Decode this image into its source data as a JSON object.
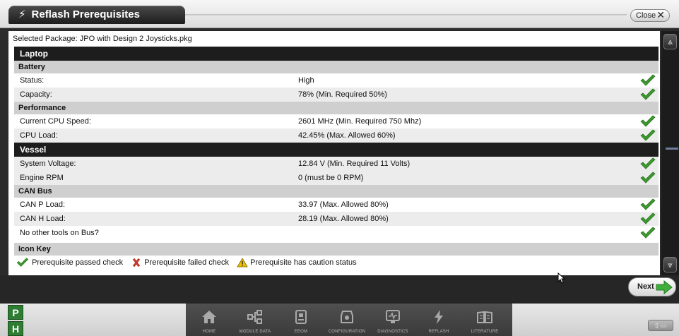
{
  "window": {
    "title": "Reflash Prerequisites",
    "title_icon": "lightning-bolt-icon",
    "close_label": "Close"
  },
  "package": {
    "text": "Selected Package: JPO with Design 2 Joysticks.pkg"
  },
  "sections": {
    "laptop": {
      "label": "Laptop",
      "battery": {
        "label": "Battery",
        "rows": [
          {
            "name": "Status:",
            "value": "High",
            "status": "passed"
          },
          {
            "name": "Capacity:",
            "value": "78% (Min. Required 50%)",
            "status": "passed"
          }
        ]
      },
      "performance": {
        "label": "Performance",
        "rows": [
          {
            "name": "Current CPU Speed:",
            "value": "2601 MHz (Min. Required 750 Mhz)",
            "status": "passed"
          },
          {
            "name": "CPU Load:",
            "value": "42.45% (Max. Allowed 60%)",
            "status": "passed"
          }
        ]
      }
    },
    "vessel": {
      "label": "Vessel",
      "rows": [
        {
          "name": "System Voltage:",
          "value": "12.84 V (Min. Required 11 Volts)",
          "status": "passed"
        },
        {
          "name": "Engine RPM",
          "value": "0 (must be 0 RPM)",
          "status": "passed"
        }
      ],
      "can_bus": {
        "label": "CAN Bus",
        "rows": [
          {
            "name": "CAN P Load:",
            "value": "33.97 (Max. Allowed 80%)",
            "status": "passed"
          },
          {
            "name": "CAN H Load:",
            "value": "28.19 (Max. Allowed 80%)",
            "status": "passed"
          },
          {
            "name": "No other tools on Bus?",
            "value": "",
            "status": "passed"
          }
        ]
      }
    },
    "icon_key": {
      "label": "Icon Key",
      "passed": "Prerequisite passed check",
      "failed": "Prerequisite failed check",
      "caution": "Prerequisite has caution status"
    }
  },
  "footer": {
    "next_label": "Next"
  },
  "bottom_nav": {
    "p_label": "P",
    "h_label": "H",
    "items": [
      {
        "label": "HOME",
        "icon": "home-icon"
      },
      {
        "label": "MODULE DATA",
        "icon": "module-data-icon"
      },
      {
        "label": "EEOM",
        "icon": "eeom-icon"
      },
      {
        "label": "CONFIGURATION",
        "icon": "configuration-icon"
      },
      {
        "label": "DIAGNOSTICS",
        "icon": "diagnostics-icon"
      },
      {
        "label": "REFLASH",
        "icon": "reflash-icon"
      },
      {
        "label": "LITERATURE",
        "icon": "literature-icon"
      }
    ]
  },
  "colors": {
    "check_green": "#3c9a2e",
    "fail_red": "#c0392b",
    "caution_yellow": "#f2c200",
    "header_dark": "#1d1d1d"
  }
}
